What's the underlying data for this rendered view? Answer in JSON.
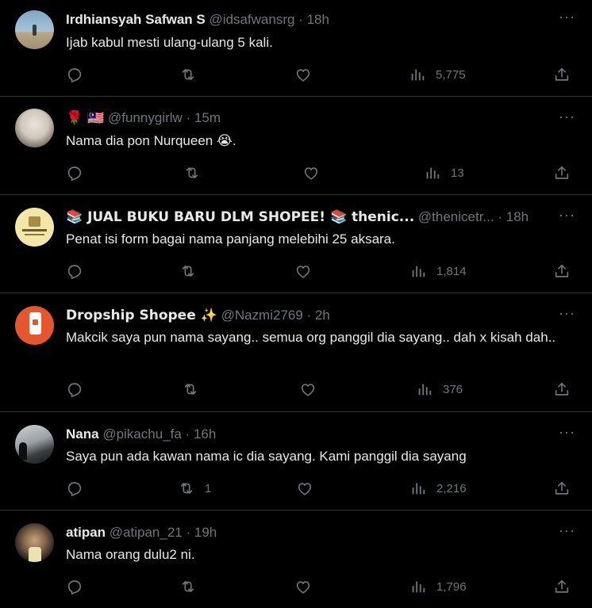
{
  "tweets": [
    {
      "name": "Irdhiansyah Safwan S",
      "handle": "@idsafwansrg",
      "time": "18h",
      "text": "Ijab kabul mesti ulang-ulang 5 kali.",
      "replies": "",
      "retweets": "",
      "views": "5,775"
    },
    {
      "name": "🌹 🇲🇾",
      "handle": "@funnygirlw",
      "time": "15m",
      "text": "Nama dia pon Nurqueen 😭.",
      "replies": "",
      "retweets": "",
      "views": "13"
    },
    {
      "name": "📚 JUAL BUKU BARU DLM SHOPEE! 📚 thenic...",
      "handle": "@thenicetr...",
      "time": "18h",
      "text": "Penat isi form bagai nama panjang melebihi 25 aksara.",
      "replies": "",
      "retweets": "",
      "views": "1,814"
    },
    {
      "name": "Dropship Shopee ✨",
      "handle": "@Nazmi2769",
      "time": "2h",
      "text": "Makcik saya pun nama sayang.. semua org panggil dia sayang.. dah x kisah dah..",
      "replies": "",
      "retweets": "",
      "views": "376"
    },
    {
      "name": "Nana",
      "handle": "@pikachu_fa",
      "time": "16h",
      "text": "Saya pun ada kawan nama ic dia sayang. Kami panggil dia sayang",
      "replies": "",
      "retweets": "1",
      "views": "2,216"
    },
    {
      "name": "atipan",
      "handle": "@atipan_21",
      "time": "19h",
      "text": "Nama orang dulu2 ni.",
      "replies": "",
      "retweets": "",
      "views": "1,796"
    }
  ],
  "separator": "·",
  "colors": {
    "background": "#000000",
    "text": "#e7e9ea",
    "muted": "#71767b",
    "divider": "#2f3336"
  },
  "icons": [
    "reply-icon",
    "retweet-icon",
    "like-icon",
    "views-icon",
    "share-icon",
    "more-icon"
  ]
}
